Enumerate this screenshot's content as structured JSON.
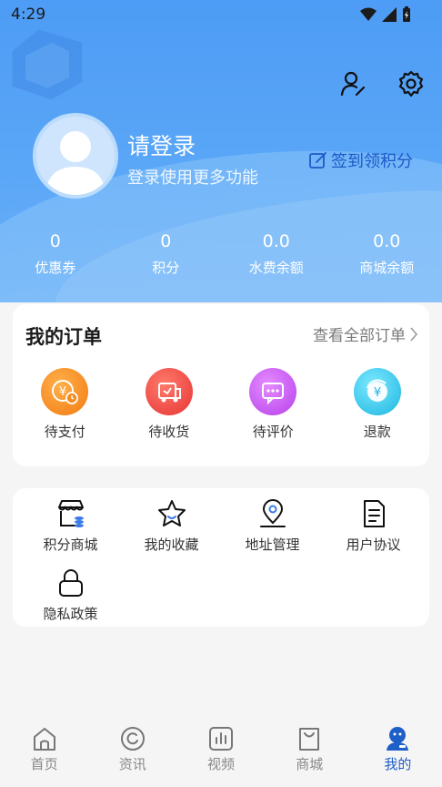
{
  "status": {
    "time": "4:29"
  },
  "profile": {
    "login_title": "请登录",
    "login_subtitle": "登录使用更多功能",
    "checkin_label": "签到领积分"
  },
  "stats": [
    {
      "value": "0",
      "label": "优惠券"
    },
    {
      "value": "0",
      "label": "积分"
    },
    {
      "value": "0.0",
      "label": "水费余额"
    },
    {
      "value": "0.0",
      "label": "商城余额"
    }
  ],
  "orders": {
    "title": "我的订单",
    "view_all": "查看全部订单",
    "items": [
      {
        "label": "待支付",
        "icon": "payment-pending-icon"
      },
      {
        "label": "待收货",
        "icon": "delivery-truck-icon"
      },
      {
        "label": "待评价",
        "icon": "comment-icon"
      },
      {
        "label": "退款",
        "icon": "refund-icon"
      }
    ]
  },
  "services": {
    "items": [
      {
        "label": "积分商城",
        "icon": "points-store-icon"
      },
      {
        "label": "我的收藏",
        "icon": "star-icon"
      },
      {
        "label": "地址管理",
        "icon": "location-pin-icon"
      },
      {
        "label": "用户协议",
        "icon": "document-icon"
      },
      {
        "label": "隐私政策",
        "icon": "lock-icon"
      }
    ]
  },
  "nav": {
    "items": [
      {
        "label": "首页",
        "icon": "home-icon"
      },
      {
        "label": "资讯",
        "icon": "news-icon"
      },
      {
        "label": "视频",
        "icon": "video-icon"
      },
      {
        "label": "商城",
        "icon": "shopping-bag-icon"
      },
      {
        "label": "我的",
        "icon": "profile-icon"
      }
    ],
    "active": "我的"
  },
  "colors": {
    "header_blue": "#4d9cf5",
    "accent_blue": "#1f5fc8",
    "pay_orange": "#f58a1f",
    "delivery_red": "#f04848",
    "comment_purple": "#c452f0",
    "refund_cyan": "#22c1e6"
  }
}
